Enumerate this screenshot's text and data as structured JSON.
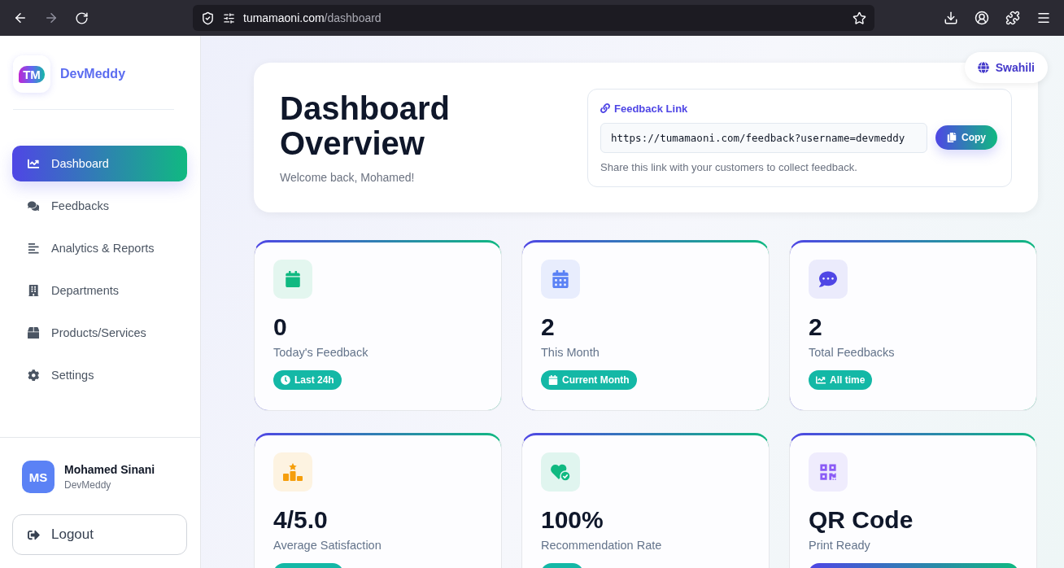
{
  "browser": {
    "back_disabled": false,
    "forward_disabled": true,
    "url": {
      "host": "tumamaoni.com",
      "path": "/dashboard"
    }
  },
  "sidebar": {
    "brand": {
      "logo_text": "TM",
      "name": "DevMeddy"
    },
    "items": [
      {
        "label": "Dashboard",
        "selected": true
      },
      {
        "label": "Feedbacks",
        "selected": false
      },
      {
        "label": "Analytics & Reports",
        "selected": false
      },
      {
        "label": "Departments",
        "selected": false
      },
      {
        "label": "Products/Services",
        "selected": false
      },
      {
        "label": "Settings",
        "selected": false
      }
    ],
    "user": {
      "initials": "MS",
      "name": "Mohamed Sinani",
      "org": "DevMeddy"
    },
    "logout": "Logout"
  },
  "language_button": "Swahili",
  "header": {
    "title": "Dashboard Overview",
    "subtitle": "Welcome back, Mohamed!",
    "feedback_link": {
      "label": "Feedback Link",
      "value": "https://tumamaoni.com/feedback?username=devmeddy",
      "copy_button": "Copy",
      "hint": "Share this link with your customers to collect feedback."
    }
  },
  "stats": [
    {
      "value": "0",
      "label": "Today's Feedback",
      "badge": "Last 24h"
    },
    {
      "value": "2",
      "label": "This Month",
      "badge": "Current Month"
    },
    {
      "value": "2",
      "label": "Total Feedbacks",
      "badge": "All time"
    },
    {
      "value": "4/5.0",
      "label": "Average Satisfaction"
    },
    {
      "value": "100%",
      "label": "Recommendation Rate"
    },
    {
      "value": "QR Code",
      "label": "Print Ready"
    }
  ]
}
